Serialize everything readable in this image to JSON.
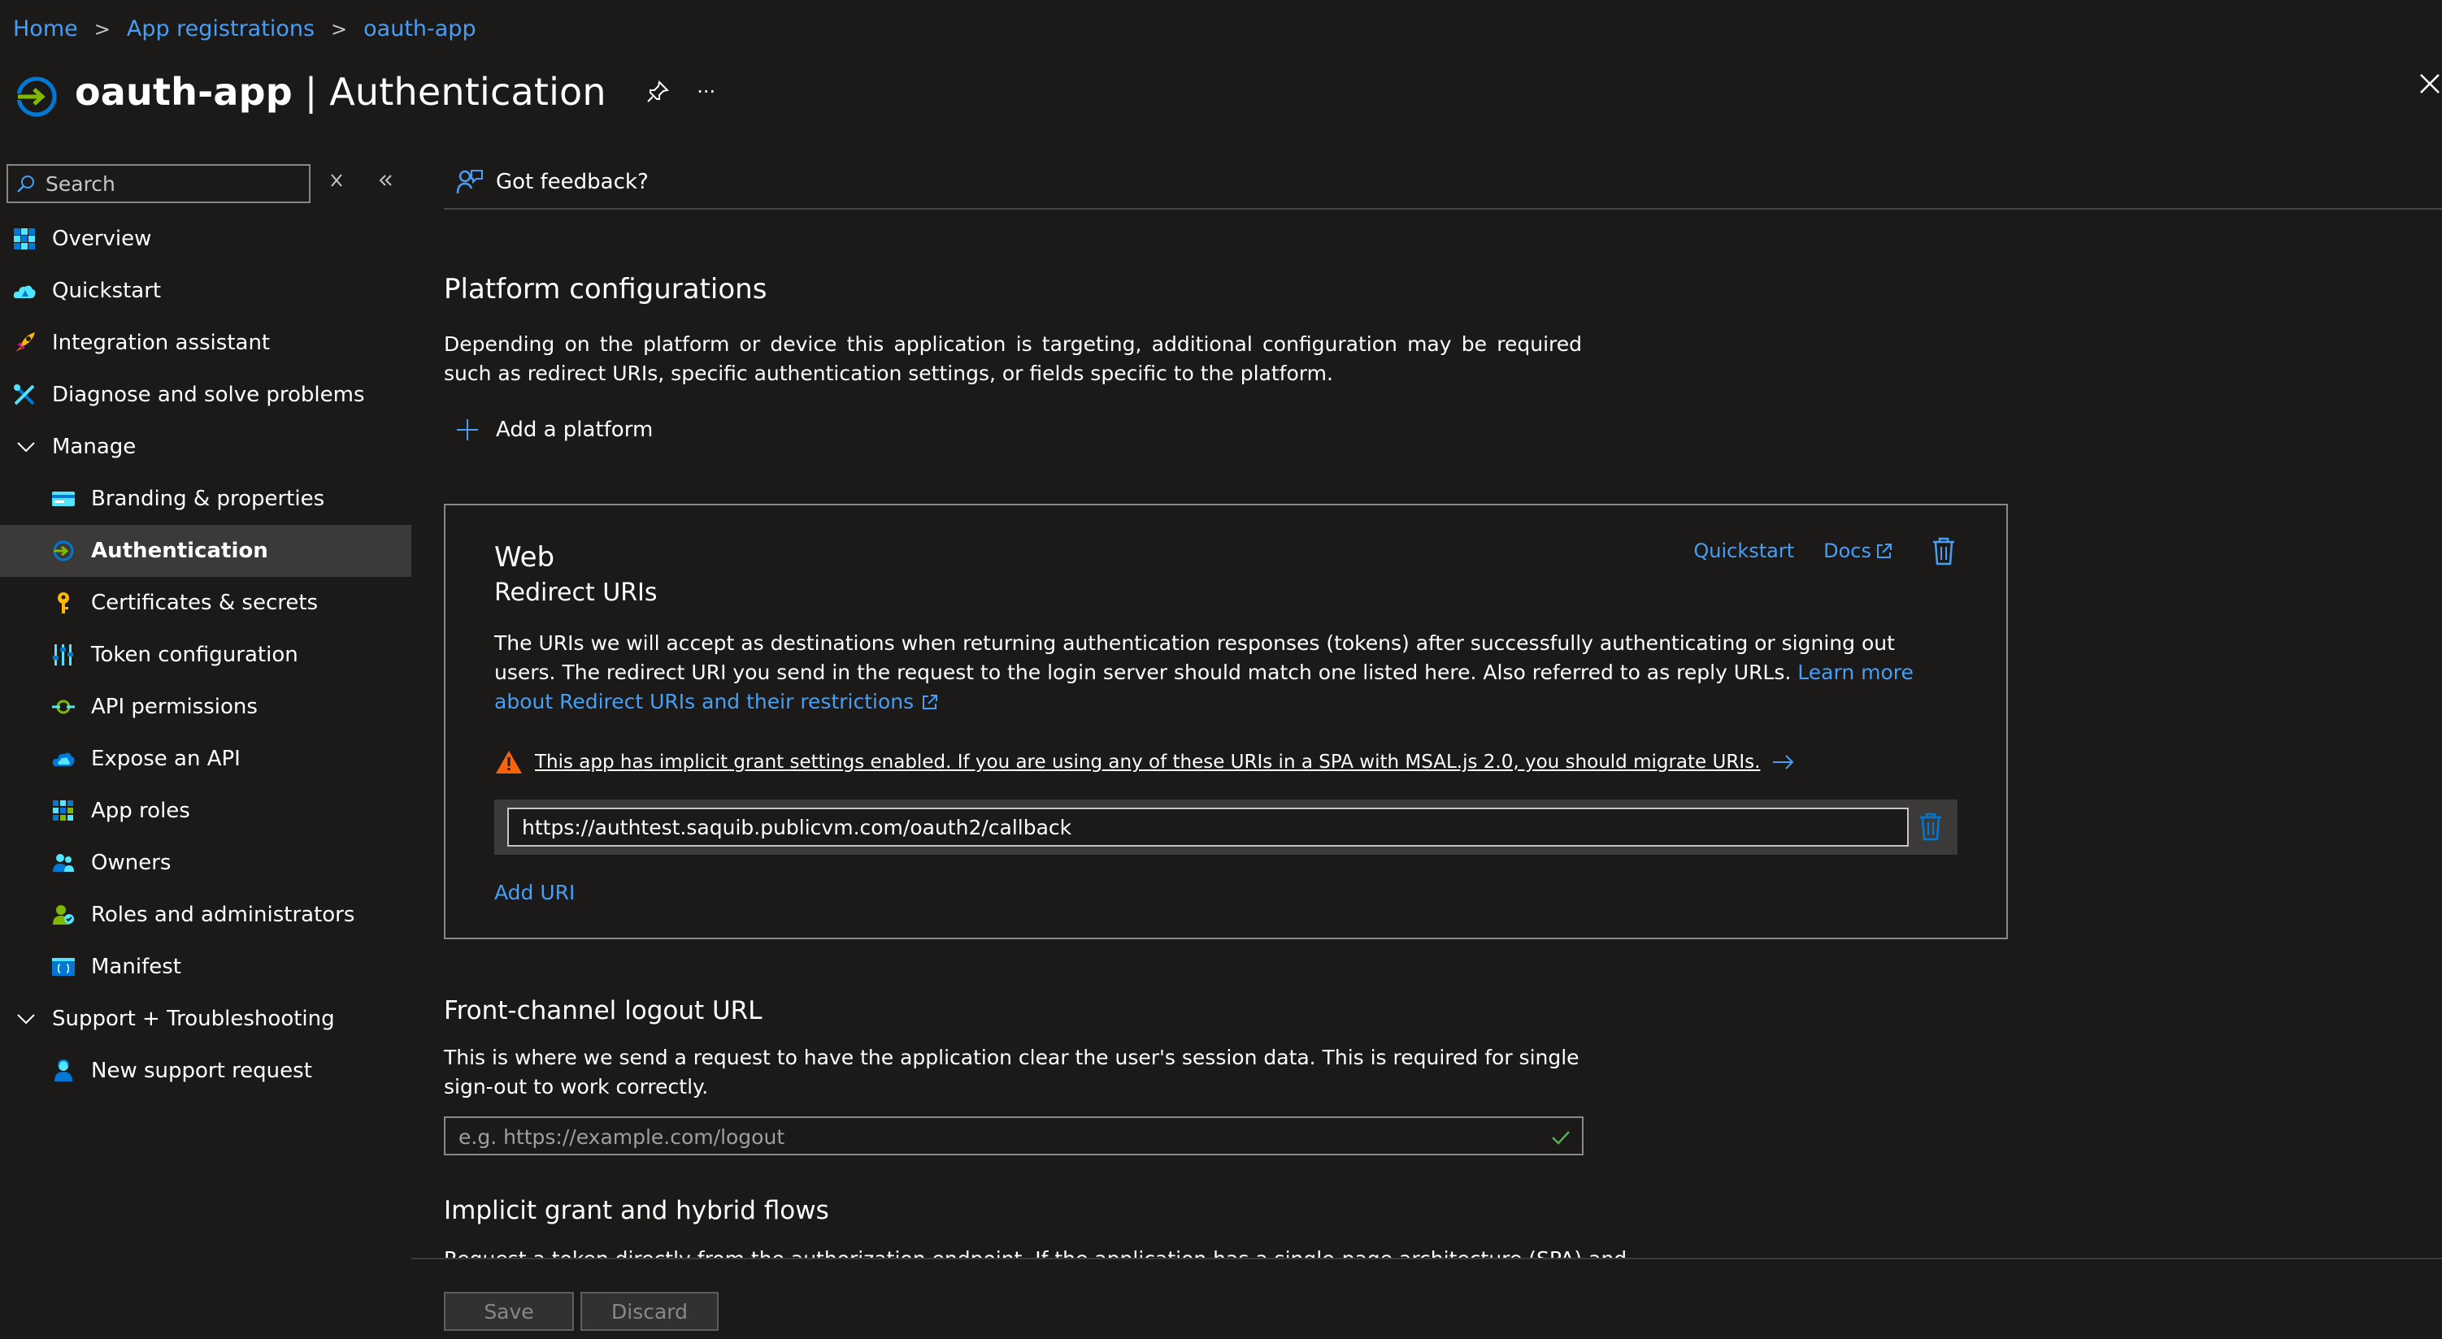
{
  "breadcrumb": [
    "Home",
    "App registrations",
    "oauth-app"
  ],
  "header": {
    "app_name": "oauth-app",
    "separator": " | ",
    "page_title": "Authentication",
    "more_label": "···"
  },
  "sidebar": {
    "search_placeholder": "Search",
    "items": [
      {
        "label": "Overview",
        "icon": "overview-icon"
      },
      {
        "label": "Quickstart",
        "icon": "quickstart-icon"
      },
      {
        "label": "Integration assistant",
        "icon": "rocket-icon"
      },
      {
        "label": "Diagnose and solve problems",
        "icon": "wrench-icon"
      },
      {
        "label": "Manage",
        "icon": "chevron-down-icon"
      },
      {
        "label": "Branding & properties",
        "icon": "branding-icon"
      },
      {
        "label": "Authentication",
        "icon": "authentication-icon"
      },
      {
        "label": "Certificates & secrets",
        "icon": "key-icon"
      },
      {
        "label": "Token configuration",
        "icon": "token-icon"
      },
      {
        "label": "API permissions",
        "icon": "api-permissions-icon"
      },
      {
        "label": "Expose an API",
        "icon": "cloud-icon"
      },
      {
        "label": "App roles",
        "icon": "grid-icon"
      },
      {
        "label": "Owners",
        "icon": "owners-icon"
      },
      {
        "label": "Roles and administrators",
        "icon": "roles-icon"
      },
      {
        "label": "Manifest",
        "icon": "manifest-icon"
      },
      {
        "label": "Support + Troubleshooting",
        "icon": "chevron-down-icon"
      },
      {
        "label": "New support request",
        "icon": "support-person-icon"
      }
    ]
  },
  "main": {
    "feedback_label": "Got feedback?",
    "platform_title": "Platform configurations",
    "platform_desc": "Depending on the platform or device this application is targeting, additional configuration may be required such as redirect URIs, specific authentication settings, or fields specific to the platform.",
    "add_platform_label": "Add a platform",
    "web_card": {
      "title": "Web",
      "subtitle": "Redirect URIs",
      "quickstart_link": "Quickstart",
      "docs_link": "Docs",
      "description": "The URIs we will accept as destinations when returning authentication responses (tokens) after successfully authenticating or signing out users. The redirect URI you send in the request to the login server should match one listed here. Also referred to as reply URLs. ",
      "learn_more_link": "Learn more about Redirect URIs and their restrictions",
      "warning": "This app has implicit grant settings enabled. If you are using any of these URIs in a SPA with MSAL.js 2.0, you should migrate URIs.",
      "redirect_uri": "https://authtest.saquib.publicvm.com/oauth2/callback",
      "add_uri_label": "Add URI"
    },
    "logout_title": "Front-channel logout URL",
    "logout_desc": "This is where we send a request to have the application clear the user's session data. This is required for single sign-out to work correctly.",
    "logout_placeholder": "e.g. https://example.com/logout",
    "implicit_title": "Implicit grant and hybrid flows",
    "implicit_desc": "Request a token directly from the authorization endpoint. If the application has a single-page architecture (SPA) and"
  },
  "footer": {
    "save_label": "Save",
    "discard_label": "Discard"
  },
  "colors": {
    "background": "#1b1a19",
    "link": "#479ef5",
    "active_row": "#3b3a39",
    "warning": "#f7630c"
  }
}
